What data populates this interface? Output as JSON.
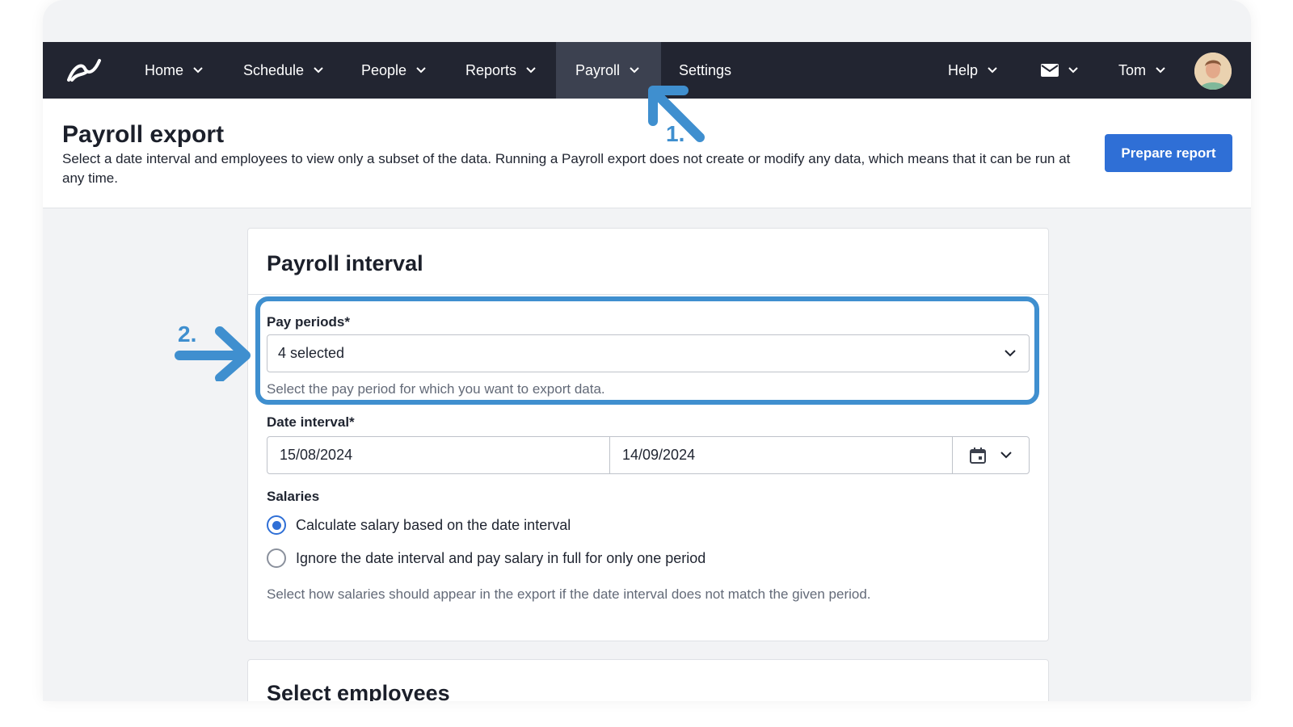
{
  "nav": {
    "items": [
      {
        "label": "Home"
      },
      {
        "label": "Schedule"
      },
      {
        "label": "People"
      },
      {
        "label": "Reports"
      },
      {
        "label": "Payroll"
      },
      {
        "label": "Settings"
      }
    ],
    "help_label": "Help",
    "user_name": "Tom",
    "active_item": "Payroll"
  },
  "header": {
    "title": "Payroll export",
    "description": "Select a date interval and employees to view only a subset of the data. Running a Payroll export does not create or modify any data, which means that it can be run at any time.",
    "prepare_button": "Prepare report"
  },
  "payroll_interval": {
    "title": "Payroll interval",
    "pay_periods": {
      "label": "Pay periods*",
      "value": "4 selected",
      "helper": "Select the pay period for which you want to export data."
    },
    "date_interval": {
      "label": "Date interval*",
      "start": "15/08/2024",
      "end": "14/09/2024"
    },
    "salaries": {
      "label": "Salaries",
      "options": [
        {
          "label": "Calculate salary based on the date interval",
          "checked": true
        },
        {
          "label": "Ignore the date interval and pay salary in full for only one period",
          "checked": false
        }
      ],
      "helper": "Select how salaries should appear in the export if the date interval does not match the given period."
    }
  },
  "select_employees": {
    "title": "Select employees"
  },
  "annotations": {
    "step1": "1.",
    "step2": "2.",
    "color": "#3f8fcf"
  },
  "colors": {
    "navbar": "#222531",
    "navbar_active": "#3c4150",
    "primary": "#2f6fd6",
    "page_bg": "#f2f3f5"
  }
}
